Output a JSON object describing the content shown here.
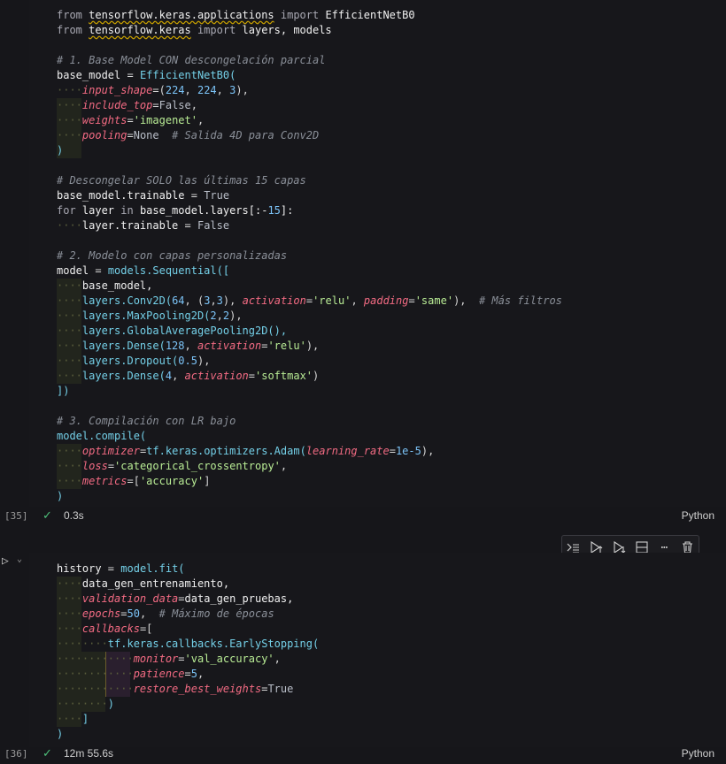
{
  "cell1": {
    "lines": [
      [
        {
          "t": "from ",
          "c": "kw"
        },
        {
          "t": "tensorflow.keras.applications",
          "c": "mod u"
        },
        {
          "t": " import ",
          "c": "kw"
        },
        {
          "t": "EfficientNetB0",
          "c": "mod"
        }
      ],
      [
        {
          "t": "from ",
          "c": "kw"
        },
        {
          "t": "tensorflow.keras",
          "c": "mod u"
        },
        {
          "t": " import ",
          "c": "kw"
        },
        {
          "t": "layers, models",
          "c": "mod"
        }
      ],
      [],
      [
        {
          "t": "# 1. Base Model CON descongelación parcial",
          "c": "cm"
        }
      ],
      [
        {
          "t": "base_model",
          "c": "mod"
        },
        {
          "t": " = ",
          "c": "op"
        },
        {
          "t": "EfficientNetB0(",
          "c": "fn"
        }
      ],
      [
        {
          "t": "    ",
          "c": "dots"
        },
        {
          "t": "input_shape",
          "c": "par"
        },
        {
          "t": "=(",
          "c": "op"
        },
        {
          "t": "224",
          "c": "num"
        },
        {
          "t": ", ",
          "c": "op"
        },
        {
          "t": "224",
          "c": "num"
        },
        {
          "t": ", ",
          "c": "op"
        },
        {
          "t": "3",
          "c": "num"
        },
        {
          "t": "),",
          "c": "op"
        }
      ],
      [
        {
          "t": "    ",
          "c": "dots"
        },
        {
          "t": "include_top",
          "c": "par"
        },
        {
          "t": "=",
          "c": "op"
        },
        {
          "t": "False",
          "c": "bool"
        },
        {
          "t": ",",
          "c": "op"
        }
      ],
      [
        {
          "t": "    ",
          "c": "dots"
        },
        {
          "t": "weights",
          "c": "par"
        },
        {
          "t": "=",
          "c": "op"
        },
        {
          "t": "'imagenet'",
          "c": "str"
        },
        {
          "t": ",",
          "c": "op"
        }
      ],
      [
        {
          "t": "    ",
          "c": "dots"
        },
        {
          "t": "pooling",
          "c": "par"
        },
        {
          "t": "=",
          "c": "op"
        },
        {
          "t": "None",
          "c": "bool"
        },
        {
          "t": "  # Salida 4D para Conv2D",
          "c": "cm"
        }
      ],
      [
        {
          "t": ")",
          "c": "fn"
        }
      ],
      [],
      [
        {
          "t": "# Descongelar SOLO las últimas 15 capas",
          "c": "cm"
        }
      ],
      [
        {
          "t": "base_model.trainable",
          "c": "mod"
        },
        {
          "t": " = ",
          "c": "op"
        },
        {
          "t": "True",
          "c": "bool"
        }
      ],
      [
        {
          "t": "for ",
          "c": "kw"
        },
        {
          "t": "layer",
          "c": "mod"
        },
        {
          "t": " in ",
          "c": "kw"
        },
        {
          "t": "base_model.layers[:-",
          "c": "mod"
        },
        {
          "t": "15",
          "c": "num"
        },
        {
          "t": "]:",
          "c": "mod"
        }
      ],
      [
        {
          "t": "    ",
          "c": "dots"
        },
        {
          "t": "layer.trainable",
          "c": "mod"
        },
        {
          "t": " = ",
          "c": "op"
        },
        {
          "t": "False",
          "c": "bool"
        }
      ],
      [],
      [
        {
          "t": "# 2. Modelo con capas personalizadas",
          "c": "cm"
        }
      ],
      [
        {
          "t": "model",
          "c": "mod"
        },
        {
          "t": " = ",
          "c": "op"
        },
        {
          "t": "models.Sequential([",
          "c": "fn"
        }
      ],
      [
        {
          "t": "    ",
          "c": "dots"
        },
        {
          "t": "base_model,",
          "c": "mod"
        }
      ],
      [
        {
          "t": "    ",
          "c": "dots"
        },
        {
          "t": "layers.Conv2D(",
          "c": "fn"
        },
        {
          "t": "64",
          "c": "num"
        },
        {
          "t": ", (",
          "c": "op"
        },
        {
          "t": "3",
          "c": "num"
        },
        {
          "t": ",",
          "c": "op"
        },
        {
          "t": "3",
          "c": "num"
        },
        {
          "t": "), ",
          "c": "op"
        },
        {
          "t": "activation",
          "c": "par"
        },
        {
          "t": "=",
          "c": "op"
        },
        {
          "t": "'relu'",
          "c": "str"
        },
        {
          "t": ", ",
          "c": "op"
        },
        {
          "t": "padding",
          "c": "par"
        },
        {
          "t": "=",
          "c": "op"
        },
        {
          "t": "'same'",
          "c": "str"
        },
        {
          "t": "),  ",
          "c": "op"
        },
        {
          "t": "# Más filtros",
          "c": "cm"
        }
      ],
      [
        {
          "t": "    ",
          "c": "dots"
        },
        {
          "t": "layers.MaxPooling2D(",
          "c": "fn"
        },
        {
          "t": "2",
          "c": "num"
        },
        {
          "t": ",",
          "c": "op"
        },
        {
          "t": "2",
          "c": "num"
        },
        {
          "t": "),",
          "c": "op"
        }
      ],
      [
        {
          "t": "    ",
          "c": "dots"
        },
        {
          "t": "layers.GlobalAveragePooling2D(),",
          "c": "fn"
        }
      ],
      [
        {
          "t": "    ",
          "c": "dots"
        },
        {
          "t": "layers.Dense(",
          "c": "fn"
        },
        {
          "t": "128",
          "c": "num"
        },
        {
          "t": ", ",
          "c": "op"
        },
        {
          "t": "activation",
          "c": "par"
        },
        {
          "t": "=",
          "c": "op"
        },
        {
          "t": "'relu'",
          "c": "str"
        },
        {
          "t": "),",
          "c": "op"
        }
      ],
      [
        {
          "t": "    ",
          "c": "dots"
        },
        {
          "t": "layers.Dropout(",
          "c": "fn"
        },
        {
          "t": "0.5",
          "c": "num"
        },
        {
          "t": "),",
          "c": "op"
        }
      ],
      [
        {
          "t": "    ",
          "c": "dots"
        },
        {
          "t": "layers.Dense(",
          "c": "fn"
        },
        {
          "t": "4",
          "c": "num"
        },
        {
          "t": ", ",
          "c": "op"
        },
        {
          "t": "activation",
          "c": "par"
        },
        {
          "t": "=",
          "c": "op"
        },
        {
          "t": "'softmax'",
          "c": "str"
        },
        {
          "t": ")",
          "c": "op"
        }
      ],
      [
        {
          "t": "])",
          "c": "fn"
        }
      ],
      [],
      [
        {
          "t": "# 3. Compilación con LR bajo",
          "c": "cm"
        }
      ],
      [
        {
          "t": "model.compile(",
          "c": "fn"
        }
      ],
      [
        {
          "t": "    ",
          "c": "dots"
        },
        {
          "t": "optimizer",
          "c": "par"
        },
        {
          "t": "=",
          "c": "op"
        },
        {
          "t": "tf.keras.optimizers.Adam(",
          "c": "fn"
        },
        {
          "t": "learning_rate",
          "c": "par"
        },
        {
          "t": "=",
          "c": "op"
        },
        {
          "t": "1e-5",
          "c": "num"
        },
        {
          "t": "),",
          "c": "op"
        }
      ],
      [
        {
          "t": "    ",
          "c": "dots"
        },
        {
          "t": "loss",
          "c": "par"
        },
        {
          "t": "=",
          "c": "op"
        },
        {
          "t": "'categorical_crossentropy'",
          "c": "str"
        },
        {
          "t": ",",
          "c": "op"
        }
      ],
      [
        {
          "t": "    ",
          "c": "dots"
        },
        {
          "t": "metrics",
          "c": "par"
        },
        {
          "t": "=[",
          "c": "op"
        },
        {
          "t": "'accuracy'",
          "c": "str"
        },
        {
          "t": "]",
          "c": "op"
        }
      ],
      [
        {
          "t": ")",
          "c": "fn"
        }
      ]
    ],
    "exec_count": "[35]",
    "duration": "0.3s",
    "language": "Python"
  },
  "cell2": {
    "lines": [
      [
        {
          "t": "history",
          "c": "mod"
        },
        {
          "t": " = ",
          "c": "op"
        },
        {
          "t": "model.fit(",
          "c": "fn"
        }
      ],
      [
        {
          "t": "    ",
          "c": "dots"
        },
        {
          "t": "data_gen_entrenamiento,",
          "c": "mod"
        }
      ],
      [
        {
          "t": "    ",
          "c": "dots"
        },
        {
          "t": "validation_data",
          "c": "par"
        },
        {
          "t": "=",
          "c": "op"
        },
        {
          "t": "data_gen_pruebas,",
          "c": "mod"
        }
      ],
      [
        {
          "t": "    ",
          "c": "dots"
        },
        {
          "t": "epochs",
          "c": "par"
        },
        {
          "t": "=",
          "c": "op"
        },
        {
          "t": "50",
          "c": "num"
        },
        {
          "t": ",  ",
          "c": "op"
        },
        {
          "t": "# Máximo de épocas",
          "c": "cm"
        }
      ],
      [
        {
          "t": "    ",
          "c": "dots"
        },
        {
          "t": "callbacks",
          "c": "par"
        },
        {
          "t": "=[",
          "c": "op"
        }
      ],
      [
        {
          "t": "        ",
          "c": "dots"
        },
        {
          "t": "tf.keras.callbacks.EarlyStopping(",
          "c": "fn"
        }
      ],
      [
        {
          "t": "            ",
          "c": "dots"
        },
        {
          "t": "monitor",
          "c": "par"
        },
        {
          "t": "=",
          "c": "op"
        },
        {
          "t": "'val_accuracy'",
          "c": "str"
        },
        {
          "t": ",",
          "c": "op"
        }
      ],
      [
        {
          "t": "            ",
          "c": "dots"
        },
        {
          "t": "patience",
          "c": "par"
        },
        {
          "t": "=",
          "c": "op"
        },
        {
          "t": "5",
          "c": "num"
        },
        {
          "t": ",",
          "c": "op"
        }
      ],
      [
        {
          "t": "            ",
          "c": "dots"
        },
        {
          "t": "restore_best_weights",
          "c": "par"
        },
        {
          "t": "=",
          "c": "op"
        },
        {
          "t": "True",
          "c": "bool"
        }
      ],
      [
        {
          "t": "        ",
          "c": "dots"
        },
        {
          "t": ")",
          "c": "fn"
        }
      ],
      [
        {
          "t": "    ",
          "c": "dots"
        },
        {
          "t": "]",
          "c": "fn"
        }
      ],
      [
        {
          "t": ")",
          "c": "fn"
        }
      ]
    ],
    "exec_count": "[36]",
    "duration": "12m 55.6s",
    "language": "Python"
  },
  "toolbar": {
    "icons": [
      "run-by-line-icon",
      "execute-above-icon",
      "execute-below-icon",
      "split-cell-icon",
      "more-icon",
      "delete-icon"
    ]
  },
  "icons": {
    "run": "run-cell-icon",
    "collapse": "chevron-down-icon",
    "success": "check-icon"
  }
}
